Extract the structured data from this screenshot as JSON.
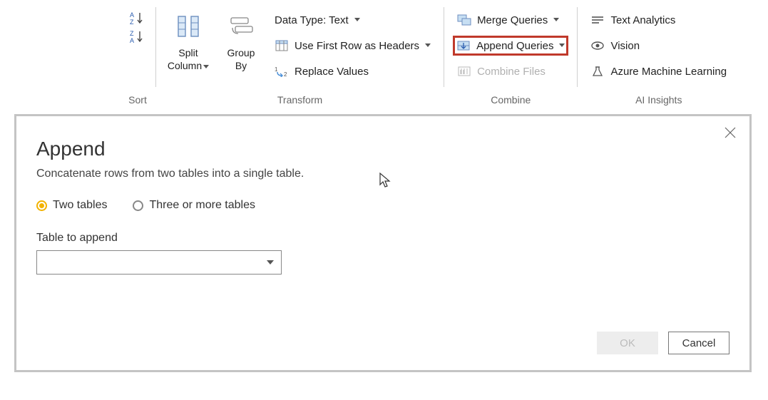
{
  "ribbon": {
    "sort": {
      "label": "Sort"
    },
    "transform": {
      "label": "Transform",
      "split_column": "Split\nColumn",
      "group_by": "Group\nBy",
      "data_type": "Data Type: Text",
      "first_row_headers": "Use First Row as Headers",
      "replace_values": "Replace Values"
    },
    "combine": {
      "label": "Combine",
      "merge_queries": "Merge Queries",
      "append_queries": "Append Queries",
      "combine_files": "Combine Files"
    },
    "ai": {
      "label": "AI Insights",
      "text_analytics": "Text Analytics",
      "vision": "Vision",
      "aml": "Azure Machine Learning"
    }
  },
  "dialog": {
    "title": "Append",
    "description": "Concatenate rows from two tables into a single table.",
    "option_two": "Two tables",
    "option_three": "Three or more tables",
    "field_label": "Table to append",
    "combo_value": "",
    "ok": "OK",
    "cancel": "Cancel"
  }
}
